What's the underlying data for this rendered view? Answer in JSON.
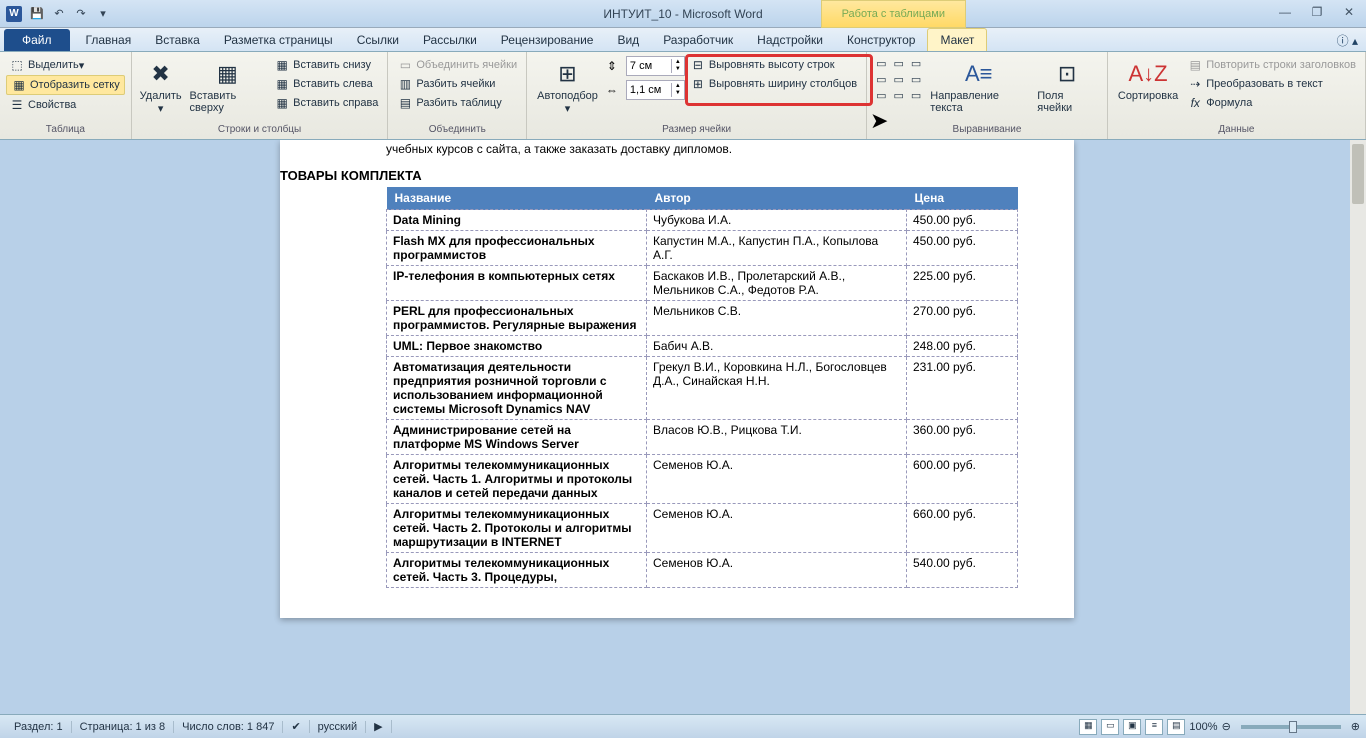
{
  "title": "ИНТУИТ_10  -  Microsoft Word",
  "contextual_tab": "Работа с таблицами",
  "tabs": {
    "file": "Файл",
    "home": "Главная",
    "insert": "Вставка",
    "page_layout": "Разметка страницы",
    "references": "Ссылки",
    "mailings": "Рассылки",
    "review": "Рецензирование",
    "view": "Вид",
    "developer": "Разработчик",
    "addins": "Надстройки",
    "design": "Конструктор",
    "layout": "Макет"
  },
  "ribbon": {
    "table": {
      "label": "Таблица",
      "select": "Выделить",
      "gridlines": "Отобразить сетку",
      "properties": "Свойства"
    },
    "rows_cols": {
      "label": "Строки и столбцы",
      "delete": "Удалить",
      "insert_above": "Вставить сверху",
      "insert_below": "Вставить снизу",
      "insert_left": "Вставить слева",
      "insert_right": "Вставить справа"
    },
    "merge": {
      "label": "Объединить",
      "merge_cells": "Объединить ячейки",
      "split_cells": "Разбить ячейки",
      "split_table": "Разбить таблицу"
    },
    "cell_size": {
      "label": "Размер ячейки",
      "autofit": "Автоподбор",
      "height": "7 см",
      "width": "1,1 см",
      "dist_rows": "Выровнять высоту строк",
      "dist_cols": "Выровнять ширину столбцов"
    },
    "alignment": {
      "label": "Выравнивание",
      "text_direction": "Направление текста",
      "cell_margins": "Поля ячейки"
    },
    "data": {
      "label": "Данные",
      "sort": "Сортировка",
      "repeat_headers": "Повторить строки заголовков",
      "convert": "Преобразовать в текст",
      "formula": "Формула"
    }
  },
  "doc": {
    "pretext": "учебных курсов с сайта, а также заказать доставку дипломов.",
    "section_title": "ТОВАРЫ КОМПЛЕКТА",
    "headers": {
      "name": "Название",
      "author": "Автор",
      "price": "Цена"
    },
    "rows": [
      {
        "name": "Data Mining",
        "author": "Чубукова И.А.",
        "price": "450.00 руб."
      },
      {
        "name": "Flash MX для профессиональных программистов",
        "author": "Капустин М.А., Капустин П.А., Копылова А.Г.",
        "price": "450.00 руб."
      },
      {
        "name": "IP-телефония в компьютерных сетях",
        "author": "Баскаков И.В., Пролетарский А.В., Мельников С.А., Федотов Р.А.",
        "price": "225.00 руб."
      },
      {
        "name": "PERL для профессиональных программистов. Регулярные выражения",
        "author": "Мельников С.В.",
        "price": "270.00 руб."
      },
      {
        "name": "UML: Первое знакомство",
        "author": "Бабич А.В.",
        "price": "248.00 руб."
      },
      {
        "name": "Автоматизация деятельности предприятия розничной торговли с использованием информационной системы Microsoft Dynamics NAV",
        "author": "Грекул В.И., Коровкина Н.Л., Богословцев Д.А., Синайская Н.Н.",
        "price": "231.00 руб."
      },
      {
        "name": "Администрирование сетей на платформе MS Windows Server",
        "author": "Власов Ю.В., Рицкова Т.И.",
        "price": "360.00 руб."
      },
      {
        "name": "Алгоритмы телекоммуникационных сетей. Часть 1. Алгоритмы и протоколы каналов и сетей передачи данных",
        "author": "Семенов Ю.А.",
        "price": "600.00 руб."
      },
      {
        "name": "Алгоритмы телекоммуникационных сетей. Часть 2. Протоколы и алгоритмы маршрутизации в INTERNET",
        "author": "Семенов Ю.А.",
        "price": "660.00 руб."
      },
      {
        "name": "Алгоритмы телекоммуникационных сетей. Часть 3. Процедуры,",
        "author": "Семенов Ю.А.",
        "price": "540.00 руб."
      }
    ]
  },
  "status": {
    "section": "Раздел: 1",
    "page": "Страница: 1 из 8",
    "words": "Число слов: 1 847",
    "lang": "русский",
    "zoom": "100%"
  }
}
